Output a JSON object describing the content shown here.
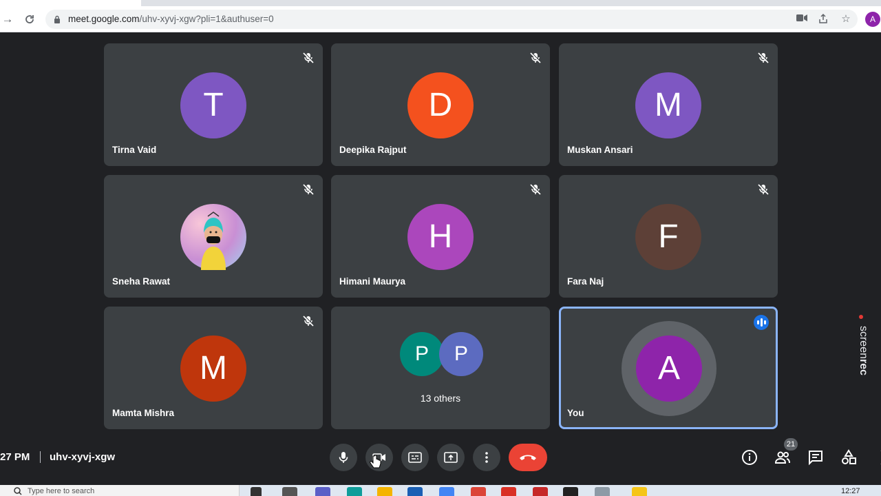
{
  "browser": {
    "url_host": "meet.google.com",
    "url_path": "/uhv-xyvj-xgw?pli=1&authuser=0",
    "profile_initial": "A"
  },
  "tiles": [
    {
      "name": "Tirna Vaid",
      "initial": "T",
      "color": "#7e57c2",
      "muted": true
    },
    {
      "name": "Deepika Rajput",
      "initial": "D",
      "color": "#f4511e",
      "muted": true
    },
    {
      "name": "Muskan Ansari",
      "initial": "M",
      "color": "#7e57c2",
      "muted": true
    },
    {
      "name": "Sneha Rawat",
      "initial": "",
      "color": "#e8a0c0",
      "muted": true,
      "photo": true
    },
    {
      "name": "Himani Maurya",
      "initial": "H",
      "color": "#ab47bc",
      "muted": true
    },
    {
      "name": "Fara Naj",
      "initial": "F",
      "color": "#5d4037",
      "muted": true
    },
    {
      "name": "Mamta Mishra",
      "initial": "M",
      "color": "#bf360c",
      "muted": true
    },
    {
      "name": "13 others",
      "initials": [
        "P",
        "P"
      ],
      "colors": [
        "#00897b",
        "#5c6bc0"
      ]
    },
    {
      "name": "You",
      "initial": "A",
      "color": "#8e24aa",
      "speaking": true
    }
  ],
  "bottom_bar": {
    "time": "27 PM",
    "meeting_code": "uhv-xyvj-xgw",
    "participant_count": "21"
  },
  "taskbar": {
    "search_placeholder": "Type here to search",
    "clock": "12:27"
  },
  "watermark": {
    "text_light": "screen",
    "text_bold": "rec"
  }
}
